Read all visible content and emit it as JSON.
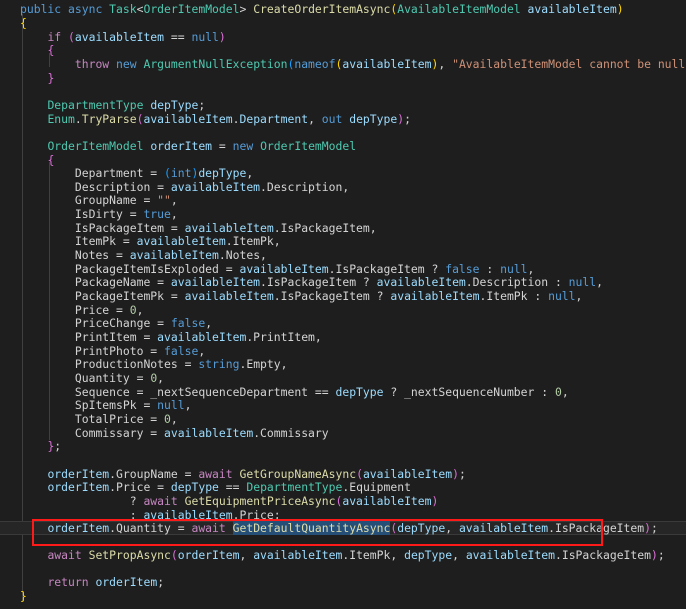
{
  "editor": {
    "lines": [
      [
        [
          "public ",
          "kw"
        ],
        [
          "async ",
          "kw"
        ],
        [
          "Task",
          "ty"
        ],
        [
          "<",
          "pu"
        ],
        [
          "OrderItemModel",
          "ty"
        ],
        [
          "> ",
          "pu"
        ],
        [
          "CreateOrderItemAsync",
          "fn"
        ],
        [
          "(",
          "br1"
        ],
        [
          "AvailableItemModel ",
          "ty"
        ],
        [
          "availableItem",
          "pr"
        ],
        [
          ")",
          "br1"
        ]
      ],
      [
        [
          "{",
          "br1"
        ]
      ],
      [
        [
          "    "
        ],
        [
          "if ",
          "ctl"
        ],
        [
          "(",
          "br2"
        ],
        [
          "availableItem",
          "pr"
        ],
        [
          " == "
        ],
        [
          "null",
          "kw"
        ],
        [
          ")",
          "br2"
        ]
      ],
      [
        [
          "    "
        ],
        [
          "{",
          "br2"
        ]
      ],
      [
        [
          "        "
        ],
        [
          "throw ",
          "ctl"
        ],
        [
          "new ",
          "kw"
        ],
        [
          "ArgumentNullException",
          "ty"
        ],
        [
          "(",
          "br3"
        ],
        [
          "nameof",
          "kw"
        ],
        [
          "(",
          "br1"
        ],
        [
          "availableItem",
          "pr"
        ],
        [
          ")",
          "br1"
        ],
        [
          ", "
        ],
        [
          "\"AvailableItemModel cannot be null.\"",
          "st"
        ],
        [
          ")",
          "br3"
        ],
        [
          ";"
        ]
      ],
      [
        [
          "    "
        ],
        [
          "}",
          "br2"
        ]
      ],
      [
        [
          ""
        ]
      ],
      [
        [
          "    "
        ],
        [
          "DepartmentType ",
          "ty"
        ],
        [
          "depType",
          "pr"
        ],
        [
          ";"
        ]
      ],
      [
        [
          "    "
        ],
        [
          "Enum",
          "ty"
        ],
        [
          "."
        ],
        [
          "TryParse",
          "fn"
        ],
        [
          "(",
          "br2"
        ],
        [
          "availableItem",
          "pr"
        ],
        [
          "."
        ],
        [
          "Department",
          "pr"
        ],
        [
          ", "
        ],
        [
          "out ",
          "kw"
        ],
        [
          "depType",
          "pr"
        ],
        [
          ")",
          "br2"
        ],
        [
          ";"
        ]
      ],
      [
        [
          ""
        ]
      ],
      [
        [
          "    "
        ],
        [
          "OrderItemModel ",
          "ty"
        ],
        [
          "orderItem",
          "pr"
        ],
        [
          " = "
        ],
        [
          "new ",
          "kw"
        ],
        [
          "OrderItemModel",
          "ty"
        ]
      ],
      [
        [
          "    "
        ],
        [
          "{",
          "br2"
        ]
      ],
      [
        [
          "        "
        ],
        [
          "Department = "
        ],
        [
          "(",
          "br3"
        ],
        [
          "int",
          "kw"
        ],
        [
          ")",
          "br3"
        ],
        [
          "depType",
          "pr"
        ],
        [
          ","
        ]
      ],
      [
        [
          "        "
        ],
        [
          "Description = "
        ],
        [
          "availableItem",
          "pr"
        ],
        [
          ".Description,"
        ]
      ],
      [
        [
          "        "
        ],
        [
          "GroupName = "
        ],
        [
          "\"\"",
          "st"
        ],
        [
          ","
        ]
      ],
      [
        [
          "        "
        ],
        [
          "IsDirty = "
        ],
        [
          "true",
          "kw"
        ],
        [
          ","
        ]
      ],
      [
        [
          "        "
        ],
        [
          "IsPackageItem = "
        ],
        [
          "availableItem",
          "pr"
        ],
        [
          ".IsPackageItem,"
        ]
      ],
      [
        [
          "        "
        ],
        [
          "ItemPk = "
        ],
        [
          "availableItem",
          "pr"
        ],
        [
          ".ItemPk,"
        ]
      ],
      [
        [
          "        "
        ],
        [
          "Notes = "
        ],
        [
          "availableItem",
          "pr"
        ],
        [
          ".Notes,"
        ]
      ],
      [
        [
          "        "
        ],
        [
          "PackageItemIsExploded = "
        ],
        [
          "availableItem",
          "pr"
        ],
        [
          ".IsPackageItem ? "
        ],
        [
          "false",
          "kw"
        ],
        [
          " : "
        ],
        [
          "null",
          "kw"
        ],
        [
          ","
        ]
      ],
      [
        [
          "        "
        ],
        [
          "PackageName = "
        ],
        [
          "availableItem",
          "pr"
        ],
        [
          ".IsPackageItem ? "
        ],
        [
          "availableItem",
          "pr"
        ],
        [
          ".Description : "
        ],
        [
          "null",
          "kw"
        ],
        [
          ","
        ]
      ],
      [
        [
          "        "
        ],
        [
          "PackageItemPk = "
        ],
        [
          "availableItem",
          "pr"
        ],
        [
          ".IsPackageItem ? "
        ],
        [
          "availableItem",
          "pr"
        ],
        [
          ".ItemPk : "
        ],
        [
          "null",
          "kw"
        ],
        [
          ","
        ]
      ],
      [
        [
          "        "
        ],
        [
          "Price = "
        ],
        [
          "0",
          "nu"
        ],
        [
          ","
        ]
      ],
      [
        [
          "        "
        ],
        [
          "PriceChange = "
        ],
        [
          "false",
          "kw"
        ],
        [
          ","
        ]
      ],
      [
        [
          "        "
        ],
        [
          "PrintItem = "
        ],
        [
          "availableItem",
          "pr"
        ],
        [
          ".PrintItem,"
        ]
      ],
      [
        [
          "        "
        ],
        [
          "PrintPhoto = "
        ],
        [
          "false",
          "kw"
        ],
        [
          ","
        ]
      ],
      [
        [
          "        "
        ],
        [
          "ProductionNotes = "
        ],
        [
          "string",
          "kw"
        ],
        [
          ".Empty,"
        ]
      ],
      [
        [
          "        "
        ],
        [
          "Quantity = "
        ],
        [
          "0",
          "nu"
        ],
        [
          ","
        ]
      ],
      [
        [
          "        "
        ],
        [
          "Sequence = _nextSequenceDepartment == "
        ],
        [
          "depType",
          "pr"
        ],
        [
          " ? _nextSequenceNumber : "
        ],
        [
          "0",
          "nu"
        ],
        [
          ","
        ]
      ],
      [
        [
          "        "
        ],
        [
          "SpItemsPk = "
        ],
        [
          "null",
          "kw"
        ],
        [
          ","
        ]
      ],
      [
        [
          "        "
        ],
        [
          "TotalPrice = "
        ],
        [
          "0",
          "nu"
        ],
        [
          ","
        ]
      ],
      [
        [
          "        "
        ],
        [
          "Commissary = "
        ],
        [
          "availableItem",
          "pr"
        ],
        [
          ".Commissary"
        ]
      ],
      [
        [
          "    "
        ],
        [
          "}",
          "br2"
        ],
        [
          ";"
        ]
      ],
      [
        [
          ""
        ]
      ],
      [
        [
          "    "
        ],
        [
          "orderItem",
          "pr"
        ],
        [
          ".GroupName = "
        ],
        [
          "await ",
          "ctl"
        ],
        [
          "GetGroupNameAsync",
          "fn"
        ],
        [
          "(",
          "br2"
        ],
        [
          "availableItem",
          "pr"
        ],
        [
          ")",
          "br2"
        ],
        [
          ";"
        ]
      ],
      [
        [
          "    "
        ],
        [
          "orderItem",
          "pr"
        ],
        [
          ".Price = "
        ],
        [
          "depType",
          "pr"
        ],
        [
          " == "
        ],
        [
          "DepartmentType",
          "ty"
        ],
        [
          ".Equipment"
        ]
      ],
      [
        [
          "                "
        ],
        [
          "? "
        ],
        [
          "await ",
          "ctl"
        ],
        [
          "GetEquipmentPriceAsync",
          "fn"
        ],
        [
          "(",
          "br2"
        ],
        [
          "availableItem",
          "pr"
        ],
        [
          ")",
          "br2"
        ]
      ],
      [
        [
          "                "
        ],
        [
          ": "
        ],
        [
          "availableItem",
          "pr"
        ],
        [
          ".Price;"
        ]
      ],
      [
        [
          "    "
        ],
        [
          "orderItem",
          "pr"
        ],
        [
          ".Quantity = "
        ],
        [
          "await ",
          "ctl"
        ],
        [
          "GetDefaultQuantityAsync",
          "fn sel"
        ],
        [
          "(",
          "br2"
        ],
        [
          "depType",
          "pr"
        ],
        [
          ", "
        ],
        [
          "availableItem",
          "pr"
        ],
        [
          ".IsPackageItem"
        ],
        [
          ")",
          "br2"
        ],
        [
          ";"
        ]
      ],
      [
        [
          ""
        ]
      ],
      [
        [
          "    "
        ],
        [
          "await ",
          "ctl"
        ],
        [
          "SetPropAsync",
          "fn"
        ],
        [
          "(",
          "br2"
        ],
        [
          "orderItem",
          "pr"
        ],
        [
          ", "
        ],
        [
          "availableItem",
          "pr"
        ],
        [
          ".ItemPk, "
        ],
        [
          "depType",
          "pr"
        ],
        [
          ", "
        ],
        [
          "availableItem",
          "pr"
        ],
        [
          ".IsPackageItem"
        ],
        [
          ")",
          "br2"
        ],
        [
          ";"
        ]
      ],
      [
        [
          ""
        ]
      ],
      [
        [
          "    "
        ],
        [
          "return ",
          "ctl"
        ],
        [
          "orderItem",
          "pr"
        ],
        [
          ";"
        ]
      ],
      [
        [
          "}",
          "br1"
        ]
      ]
    ]
  }
}
